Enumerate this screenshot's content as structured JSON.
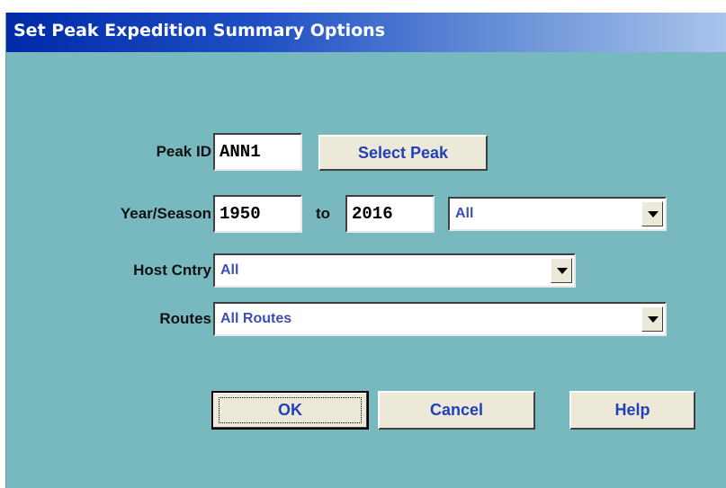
{
  "window": {
    "title": "Set Peak Expedition Summary Options"
  },
  "peak_id": {
    "label": "Peak ID",
    "value": "ANN1",
    "select_button": "Select Peak"
  },
  "year_season": {
    "label": "Year/Season",
    "from_value": "1950",
    "to_label": "to",
    "to_value": "2016",
    "season_value": "All"
  },
  "host_country": {
    "label": "Host Cntry",
    "value": "All"
  },
  "routes": {
    "label": "Routes",
    "value": "All Routes"
  },
  "buttons": {
    "ok": "OK",
    "cancel": "Cancel",
    "help": "Help"
  },
  "colors": {
    "dialog_background": "#78b9c0",
    "titlebar_start": "#002aa8",
    "titlebar_end": "#a9c4ec",
    "button_text": "#2340b8",
    "combo_text": "#3c4fb4"
  },
  "icons": {
    "dropdown_arrow": "chevron-down-icon"
  }
}
